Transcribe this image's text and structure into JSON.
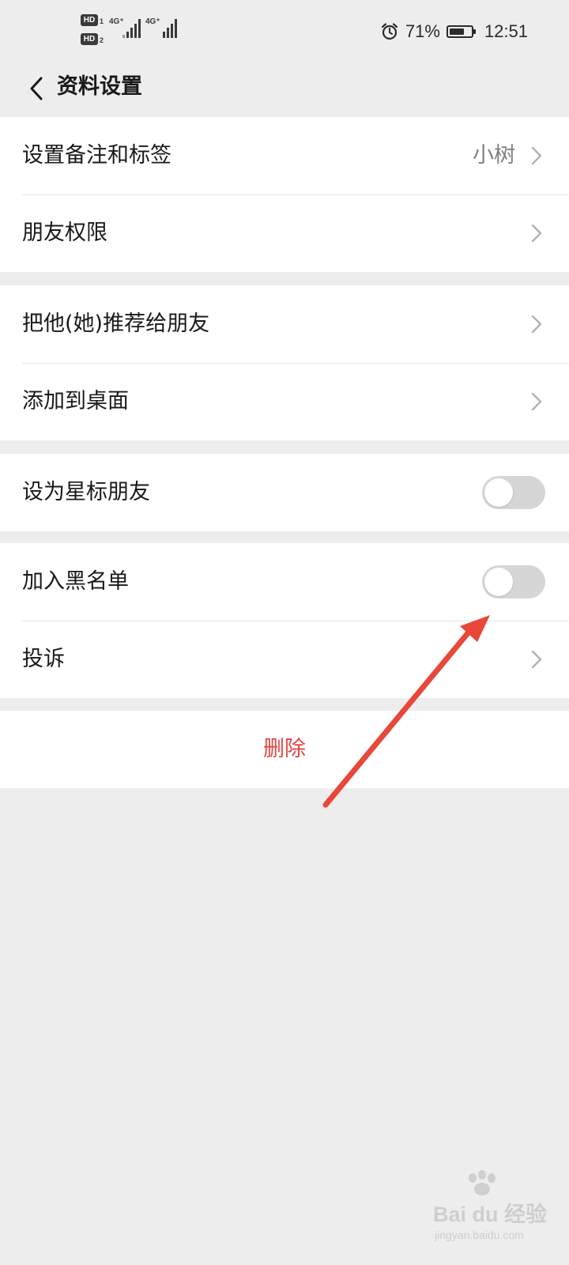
{
  "status_bar": {
    "sim1_badge": "HD",
    "sim1_num": "1",
    "sim2_badge": "HD",
    "sim2_num": "2",
    "network1": "4G⁺",
    "network2": "4G⁺",
    "battery_percent": "71%",
    "battery_level": 0.71,
    "time": "12:51",
    "icons": [
      "hd-icon",
      "signal-icon",
      "alarm-icon",
      "battery-icon"
    ]
  },
  "nav": {
    "title": "资料设置",
    "back_icon": "chevron-left-icon"
  },
  "groups": [
    {
      "rows": [
        {
          "label": "设置备注和标签",
          "value": "小树",
          "control": "chevron"
        },
        {
          "label": "朋友权限",
          "control": "chevron"
        }
      ]
    },
    {
      "rows": [
        {
          "label": "把他(她)推荐给朋友",
          "control": "chevron"
        },
        {
          "label": "添加到桌面",
          "control": "chevron"
        }
      ]
    },
    {
      "rows": [
        {
          "label": "设为星标朋友",
          "control": "toggle",
          "on": false
        }
      ]
    },
    {
      "rows": [
        {
          "label": "加入黑名单",
          "control": "toggle",
          "on": false
        },
        {
          "label": "投诉",
          "control": "chevron"
        }
      ]
    }
  ],
  "delete_label": "删除",
  "colors": {
    "background": "#ededed",
    "card": "#ffffff",
    "text": "#191919",
    "secondary_text": "#808080",
    "danger": "#e64340",
    "toggle_off": "#d6d6d6",
    "annotation_arrow": "#e8473a",
    "watermark": "#cfcfcf"
  },
  "watermark": {
    "text": "Bai du 经验",
    "sub": "jingyan.baidu.com"
  }
}
